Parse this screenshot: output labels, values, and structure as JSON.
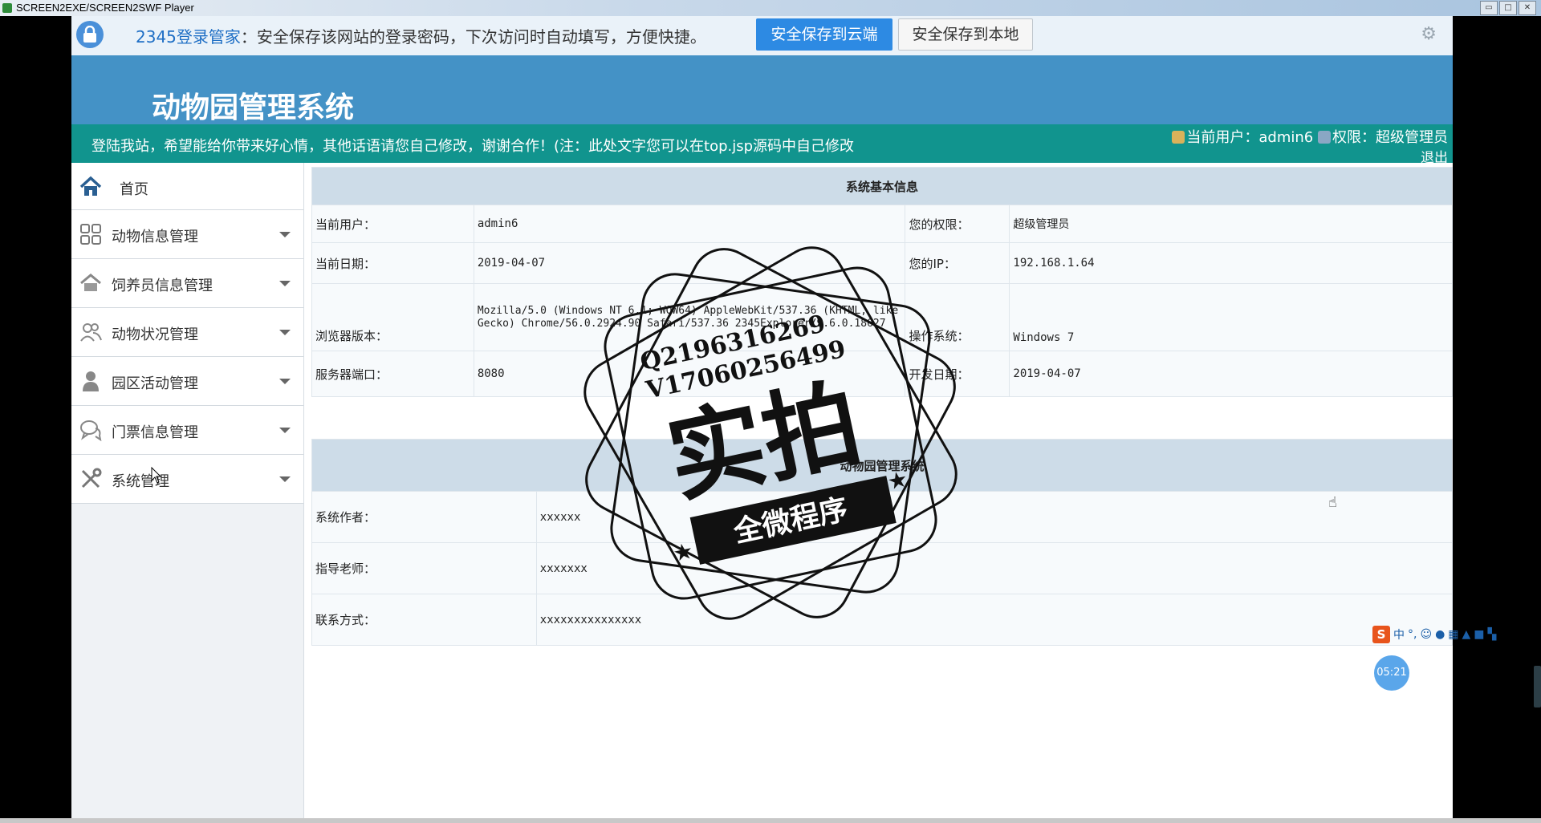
{
  "player": {
    "title": "SCREEN2EXE/SCREEN2SWF Player",
    "window_buttons": [
      "▭",
      "□",
      "✕"
    ]
  },
  "password_bar": {
    "brand": "2345登录管家",
    "message": "：安全保存该网站的登录密码，下次访问时自动填写，方便快捷。",
    "save_cloud": "安全保存到云端",
    "save_local": "安全保存到本地",
    "settings_icon": "gear-icon"
  },
  "header": {
    "title": "动物园管理系统",
    "notice": "登陆我站，希望能给你带来好心情，其他话语请您自己修改，谢谢合作！(注：此处文字您可以在top.jsp源码中自己修改",
    "current_user_label": "当前用户：",
    "current_user": "admin6",
    "role_label": "权限：",
    "role": "超级管理员",
    "logout": "退出"
  },
  "sidebar": {
    "items": [
      {
        "label": "首页",
        "icon": "home-icon"
      },
      {
        "label": "动物信息管理",
        "icon": "grid-icon"
      },
      {
        "label": "饲养员信息管理",
        "icon": "house-icon"
      },
      {
        "label": "动物状况管理",
        "icon": "users-icon"
      },
      {
        "label": "园区活动管理",
        "icon": "person-icon"
      },
      {
        "label": "门票信息管理",
        "icon": "chat-icon"
      },
      {
        "label": "系统管理",
        "icon": "tools-icon"
      }
    ]
  },
  "sysinfo": {
    "heading": "系统基本信息",
    "rows": [
      {
        "l1": "当前用户：",
        "v1": "admin6",
        "l2": "您的权限：",
        "v2": "超级管理员"
      },
      {
        "l1": "当前日期：",
        "v1": "2019-04-07",
        "l2": "您的IP：",
        "v2": "192.168.1.64"
      },
      {
        "l1": "浏览器版本：",
        "v1": "Mozilla/5.0 (Windows NT 6.1; WOW64) AppleWebKit/537.36 (KHTML, like Gecko) Chrome/56.0.2924.90 Safari/537.36 2345Explorer/9.6.0.18627",
        "l2": "操作系统：",
        "v2": "Windows 7"
      },
      {
        "l1": "服务器端口：",
        "v1": "8080",
        "l2": "开发日期：",
        "v2": "2019-04-07"
      }
    ]
  },
  "about": {
    "heading": "动物园管理系统",
    "rows": [
      {
        "label": "系统作者：",
        "value": "xxxxxx"
      },
      {
        "label": "指导老师：",
        "value": "xxxxxxx"
      },
      {
        "label": "联系方式：",
        "value": "xxxxxxxxxxxxxxx"
      }
    ]
  },
  "watermark": {
    "line1": "Q2196316269",
    "line2": "V17060256499",
    "big": "实拍",
    "ribbon": "全微程序"
  },
  "ime": {
    "brand": "S",
    "mode": "中",
    "punct": "°,"
  },
  "timer": "05:21"
}
